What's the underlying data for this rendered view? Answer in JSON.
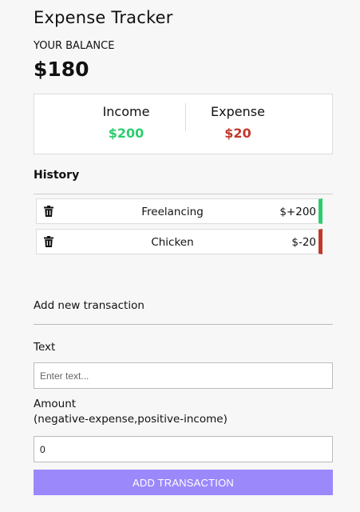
{
  "app": {
    "title": "Expense Tracker"
  },
  "balance": {
    "label": "YOUR BALANCE",
    "value": "$180"
  },
  "summary": {
    "income_label": "Income",
    "income_value": "$200",
    "expense_label": "Expense",
    "expense_value": "$20"
  },
  "history": {
    "heading": "History",
    "items": [
      {
        "text": "Freelancing",
        "amount": "$+200",
        "type": "income",
        "icon": "trash-icon"
      },
      {
        "text": "Chicken",
        "amount": "$-20",
        "type": "expense",
        "icon": "trash-icon"
      }
    ]
  },
  "form": {
    "heading": "Add new transaction",
    "text_label": "Text",
    "text_placeholder": "Enter text...",
    "text_value": "",
    "amount_label": "Amount",
    "amount_hint": "(negative-expense,positive-income)",
    "amount_value": "0",
    "submit_label": "ADD TRANSACTION"
  },
  "colors": {
    "income": "#2ecc71",
    "expense": "#c0392b",
    "button": "#9b88fb"
  }
}
